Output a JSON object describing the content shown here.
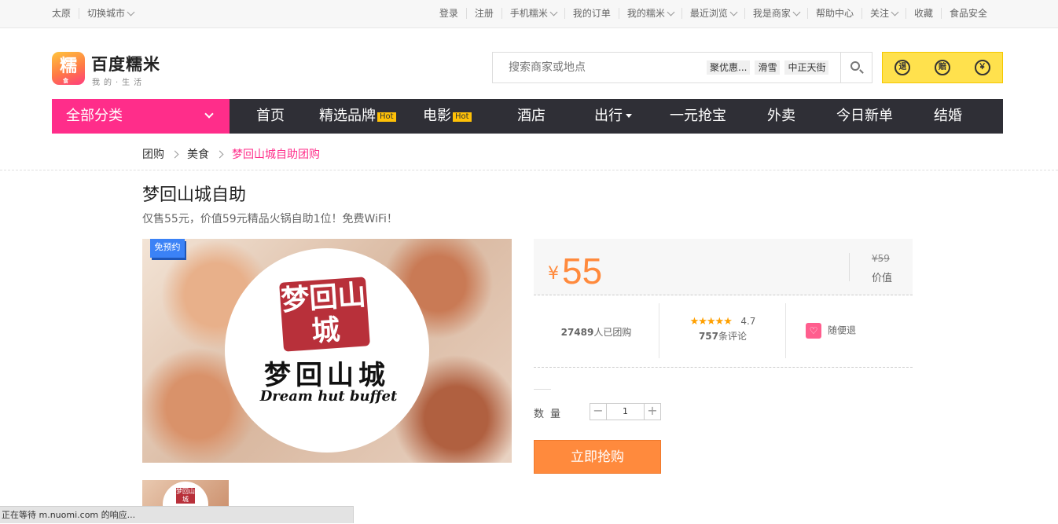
{
  "topbar": {
    "city": "太原",
    "switch_city": "切换城市",
    "links": [
      "登录",
      "注册",
      "手机糯米",
      "我的订单",
      "我的糯米",
      "最近浏览",
      "我是商家",
      "帮助中心",
      "关注",
      "收藏",
      "食品安全"
    ]
  },
  "header": {
    "logo_char": "糯",
    "logo_sub": "食",
    "brand": "百度糯米",
    "slogan": "我的·生活",
    "search_placeholder": "搜索商家或地点",
    "hot_words": [
      "聚优惠...",
      "滑雪",
      "中正天街"
    ],
    "guarantees": [
      "退",
      "赔",
      "￥"
    ]
  },
  "nav": {
    "category": "全部分类",
    "items": [
      "首页",
      "精选品牌",
      "电影",
      "酒店",
      "出行",
      "一元抢宝",
      "外卖",
      "今日新单",
      "结婚"
    ],
    "hot_label": "Hot"
  },
  "breadcrumb": [
    "团购",
    "美食",
    "梦回山城自助团购"
  ],
  "deal": {
    "title": "梦回山城自助",
    "subtitle": "仅售55元，价值59元精品火锅自助1位！免费WiFi！",
    "badge": "免预约",
    "logo_seal": "梦回山城",
    "logo_cn": "梦回山城",
    "logo_en": "Dream hut buffet",
    "currency": "¥",
    "price": "55",
    "original_price": "¥59",
    "original_label": "价值",
    "sold_count": "27489",
    "sold_suffix": "人已团购",
    "rating": "4.7",
    "review_count": "757",
    "review_suffix": "条评论",
    "refund": "随便退",
    "qty_label": "数量",
    "qty": "1",
    "buy_label": "立即抢购"
  },
  "status_bar": "正在等待 m.nuomi.com 的响应..."
}
